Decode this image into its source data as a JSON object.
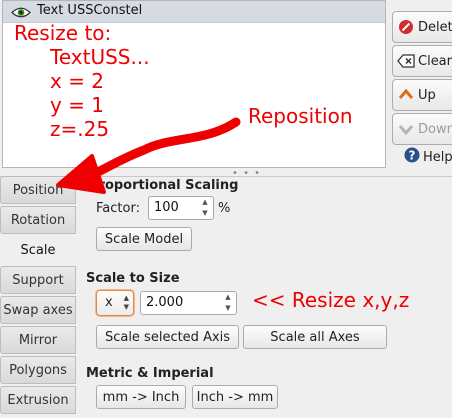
{
  "object_list": {
    "items": [
      {
        "label": "Text USSConstel",
        "icon": "eye-icon"
      }
    ]
  },
  "actions": {
    "delete": {
      "label": "Delete",
      "icon": "delete-icon",
      "color": "#d22d2d"
    },
    "clear": {
      "label": "Clear",
      "icon": "clear-icon"
    },
    "up": {
      "label": "Up",
      "icon": "arrow-up-icon",
      "color": "#e06a1b"
    },
    "down": {
      "label": "Down",
      "icon": "arrow-down-icon",
      "enabled": false
    },
    "help": {
      "label": "Help",
      "icon": "help-icon",
      "color": "#2a4f8a"
    }
  },
  "tabs": [
    {
      "label": "Position",
      "active": false
    },
    {
      "label": "Rotation",
      "active": false
    },
    {
      "label": "Scale",
      "active": true
    },
    {
      "label": "Support",
      "active": false
    },
    {
      "label": "Swap axes",
      "active": false
    },
    {
      "label": "Mirror",
      "active": false
    },
    {
      "label": "Polygons",
      "active": false
    },
    {
      "label": "Extrusion",
      "active": false
    }
  ],
  "scale_panel": {
    "proportional": {
      "title": "Proportional Scaling",
      "factor_label": "Factor:",
      "factor_value": "100",
      "unit": "%",
      "button": "Scale Model"
    },
    "to_size": {
      "title": "Scale to Size",
      "axis_value": "x",
      "size_value": "2.000",
      "scale_selected_button": "Scale selected Axis",
      "scale_all_button": "Scale all Axes"
    },
    "metric": {
      "title": "Metric & Imperial",
      "mm_to_inch": "mm -> Inch",
      "inch_to_mm": "Inch -> mm"
    }
  },
  "annotations": {
    "color": "#ee0000",
    "resize_lines": [
      "Resize to:",
      "TextUSS...",
      "x = 2",
      "y = 1",
      "z=.25"
    ],
    "reposition": "Reposition",
    "resize_xyz": "<< Resize x,y,z"
  }
}
